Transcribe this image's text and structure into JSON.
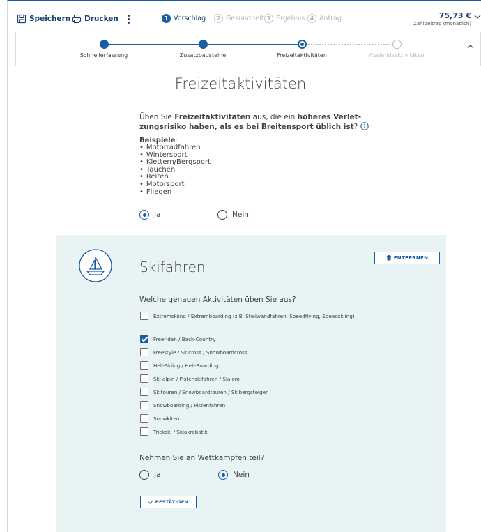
{
  "toolbar": {
    "save_label": "Speichern",
    "print_label": "Drucken",
    "steps": [
      {
        "num": "1",
        "label": "Vorschlag",
        "active": true
      },
      {
        "num": "2",
        "label": "Gesundheit",
        "active": false
      },
      {
        "num": "3",
        "label": "Ergebnis",
        "active": false
      },
      {
        "num": "4",
        "label": "Antrag",
        "active": false
      }
    ],
    "price": "75,73 €",
    "price_label": "Zahlbeitrag (monatlich)"
  },
  "progress": {
    "steps": [
      {
        "label": "Schnellerfassung",
        "state": "done"
      },
      {
        "label": "Zusatzbausteine",
        "state": "done"
      },
      {
        "label": "Freizeitaktivitäten",
        "state": "current"
      },
      {
        "label": "Auslandsaktivitäten",
        "state": "todo"
      }
    ]
  },
  "main": {
    "title": "Freizeitaktivitäten",
    "question_p1": "Üben Sie ",
    "question_b1": "Freizeitaktivitäten",
    "question_p2": " aus, die ein ",
    "question_b2": "höheres Verlet-zungsrisiko haben, als es bei Breitensport üblich ist",
    "question_p3": "?",
    "examples_title": "Beispiele",
    "examples_colon": ":",
    "examples": [
      "Motorradfahren",
      "Wintersport",
      "Klettern/Bergsport",
      "Tauchen",
      "Reiten",
      "Motorsport",
      "Fliegen"
    ],
    "radio_yes": "Ja",
    "radio_no": "Nein",
    "selected": "Ja"
  },
  "ski_panel": {
    "title": "Skifahren",
    "remove_label": "ENTFERNEN",
    "question": "Welche genauen Aktivitäten üben Sie aus?",
    "activities": [
      {
        "label": "Extremskiing / Extremboarding (z.B. Steilwandfahren, Speedflying, Speedskiing)",
        "checked": false
      },
      {
        "label": "Freeriden / Back-Country",
        "checked": true
      },
      {
        "label": "Freestyle / Skicross / Snowboardcross",
        "checked": false
      },
      {
        "label": "Heli-Skiing / Heli-Boarding",
        "checked": false
      },
      {
        "label": "Ski alpin / Pistenskifahren / Slalom",
        "checked": false
      },
      {
        "label": "Skitouren / Snowboardtouren / Skibergsteigen",
        "checked": false
      },
      {
        "label": "Snowboarding / Pistenfahren",
        "checked": false
      },
      {
        "label": "Snowkiten",
        "checked": false
      },
      {
        "label": "Trickski / Skiakrobatik",
        "checked": false
      }
    ],
    "competition_question": "Nehmen Sie an Wettkämpfen teil?",
    "radio_yes": "Ja",
    "radio_no": "Nein",
    "competition_selected": "Nein",
    "confirm_label": "BESTÄTIGEN"
  },
  "colors": {
    "accent": "#1b5ea6",
    "panel_bg": "#e8f4f4",
    "text": "#414141"
  }
}
